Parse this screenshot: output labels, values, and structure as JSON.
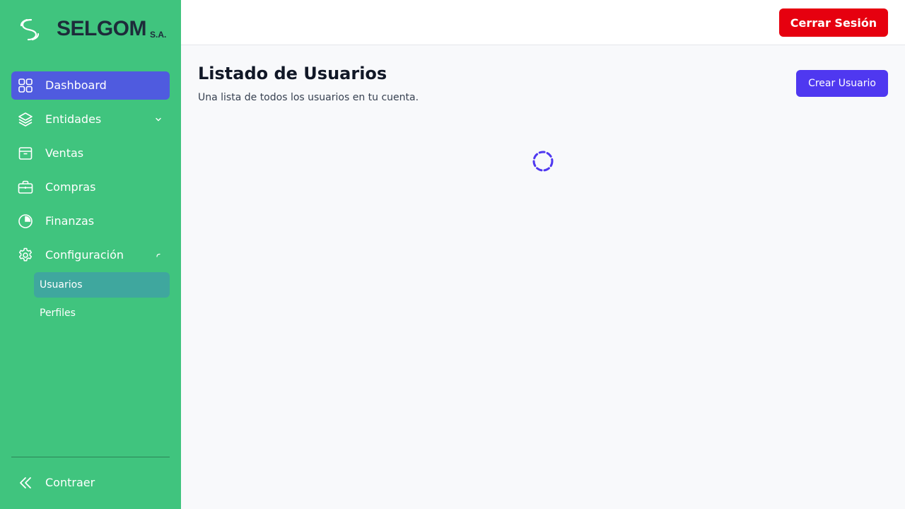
{
  "brand": {
    "name": "SELGOM",
    "suffix": "S.A."
  },
  "sidebar": {
    "items": [
      {
        "label": "Dashboard",
        "icon": "grid-icon"
      },
      {
        "label": "Entidades",
        "icon": "layers-icon"
      },
      {
        "label": "Ventas",
        "icon": "archive-box-icon"
      },
      {
        "label": "Compras",
        "icon": "briefcase-icon"
      },
      {
        "label": "Finanzas",
        "icon": "pie-chart-icon"
      },
      {
        "label": "Configuración",
        "icon": "gear-icon"
      }
    ],
    "subitems": [
      {
        "label": "Usuarios"
      },
      {
        "label": "Perfiles"
      }
    ],
    "collapse_label": "Contraer"
  },
  "header": {
    "logout_label": "Cerrar Sesión"
  },
  "main": {
    "title": "Listado de Usuarios",
    "subtitle": "Una lista de todos los usuarios en tu cuenta.",
    "create_label": "Crear Usuario"
  },
  "colors": {
    "sidebar": "#40c47e",
    "active_nav": "#4f5bdf",
    "active_sub": "#3fa79e",
    "logout": "#e6000f",
    "primary": "#4f38f0",
    "brand_text": "#1d2b3a"
  }
}
